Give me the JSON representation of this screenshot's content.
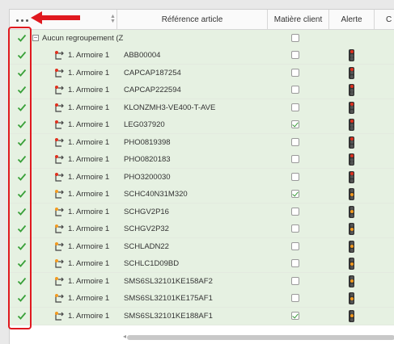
{
  "header": {
    "reference_label": "Référence article",
    "matiere_label": "Matière client",
    "alerte_label": "Alerte",
    "next_col_label": "C",
    "sort_icon": "sort-arrows-icon",
    "menu_icon": "more-dots-icon"
  },
  "group": {
    "label": "Aucun regroupement (Z",
    "toggle": "−"
  },
  "rows": [
    {
      "armoire": "1. Armoire 1",
      "ref": "ABB00004",
      "matiere": false,
      "alert": "red"
    },
    {
      "armoire": "1. Armoire 1",
      "ref": "CAPCAP187254",
      "matiere": false,
      "alert": "red"
    },
    {
      "armoire": "1. Armoire 1",
      "ref": "CAPCAP222594",
      "matiere": false,
      "alert": "red"
    },
    {
      "armoire": "1. Armoire 1",
      "ref": "KLONZMH3-VE400-T-AVE",
      "matiere": false,
      "alert": "red"
    },
    {
      "armoire": "1. Armoire 1",
      "ref": "LEG037920",
      "matiere": true,
      "alert": "red"
    },
    {
      "armoire": "1. Armoire 1",
      "ref": "PHO0819398",
      "matiere": false,
      "alert": "red"
    },
    {
      "armoire": "1. Armoire 1",
      "ref": "PHO0820183",
      "matiere": false,
      "alert": "red"
    },
    {
      "armoire": "1. Armoire 1",
      "ref": "PHO3200030",
      "matiere": false,
      "alert": "red"
    },
    {
      "armoire": "1. Armoire 1",
      "ref": "SCHC40N31M320",
      "matiere": true,
      "alert": "orange"
    },
    {
      "armoire": "1. Armoire 1",
      "ref": "SCHGV2P16",
      "matiere": false,
      "alert": "orange"
    },
    {
      "armoire": "1. Armoire 1",
      "ref": "SCHGV2P32",
      "matiere": false,
      "alert": "orange"
    },
    {
      "armoire": "1. Armoire 1",
      "ref": "SCHLADN22",
      "matiere": false,
      "alert": "orange"
    },
    {
      "armoire": "1. Armoire 1",
      "ref": "SCHLC1D09BD",
      "matiere": false,
      "alert": "orange"
    },
    {
      "armoire": "1. Armoire 1",
      "ref": "SMS6SL32101KE158AF2",
      "matiere": false,
      "alert": "orange"
    },
    {
      "armoire": "1. Armoire 1",
      "ref": "SMS6SL32101KE175AF1",
      "matiere": false,
      "alert": "orange"
    },
    {
      "armoire": "1. Armoire 1",
      "ref": "SMS6SL32101KE188AF1",
      "matiere": true,
      "alert": "orange"
    }
  ],
  "colors": {
    "row_bg": "#e6f1e2",
    "check_green": "#3aa13a",
    "annotation_red": "#e0191f",
    "light_red": "#e0301e",
    "light_orange": "#f29a1f"
  }
}
